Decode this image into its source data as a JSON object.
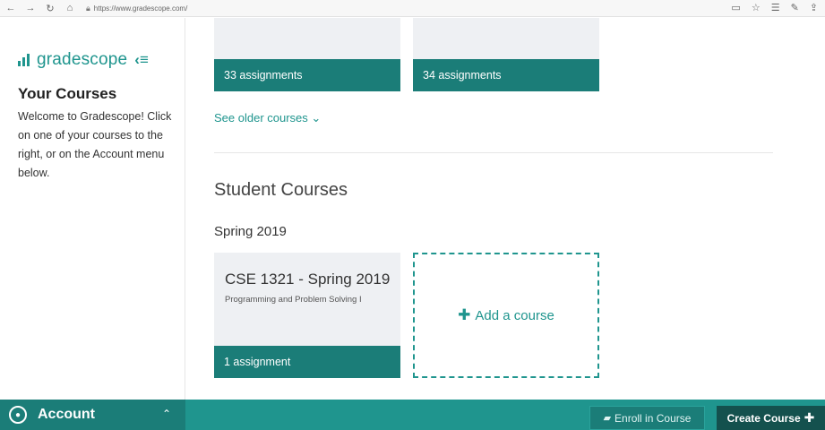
{
  "browser": {
    "url": "https://www.gradescope.com/",
    "icons": [
      "back-arrow-icon",
      "forward-arrow-icon",
      "reload-icon",
      "home-icon",
      "lock-icon",
      "reader-icon",
      "favorite-star-icon",
      "favorites-icon",
      "pen-icon",
      "share-icon"
    ]
  },
  "sidebar": {
    "logo_text": "gradescope",
    "title": "Your Courses",
    "welcome": "Welcome to Gradescope! Click on one of your courses to the right, or on the Account menu below."
  },
  "main": {
    "top_cards": [
      {
        "assignments": "33 assignments"
      },
      {
        "assignments": "34 assignments"
      }
    ],
    "see_older": "See older courses",
    "student_section": "Student Courses",
    "term": "Spring 2019",
    "course": {
      "title": "CSE 1321 - Spring 2019",
      "subtitle": "Programming and Problem Solving I",
      "assignments": "1 assignment"
    },
    "add_course": "Add a course"
  },
  "bottombar": {
    "account_label": "Account",
    "enroll_label": "Enroll in Course",
    "create_label": "Create Course"
  },
  "colors": {
    "brand": "#1f958e",
    "brand_dark": "#1b7d78",
    "create_button": "#14514e"
  }
}
